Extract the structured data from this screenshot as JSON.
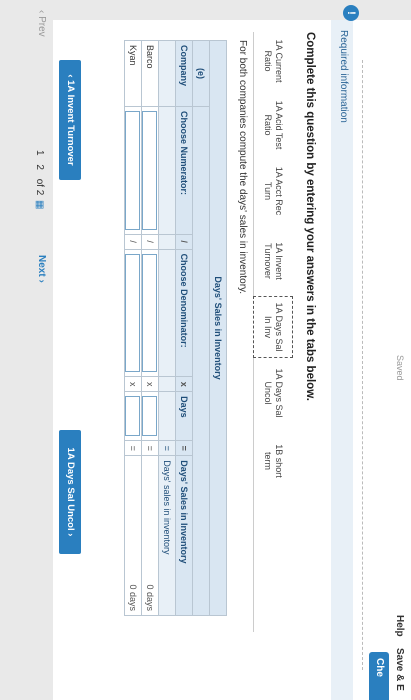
{
  "header": {
    "status": "Saved",
    "help": "Help",
    "save": "Save & E",
    "check": "Che"
  },
  "alert": {
    "icon_text": "!",
    "required": "Required information"
  },
  "question": "Complete this question by entering your answers in the tabs below.",
  "tabs": [
    {
      "label": "1A Current Ratio"
    },
    {
      "label": "1A Acid Test Ratio"
    },
    {
      "label": "1A Acct Rec Turn"
    },
    {
      "label": "1A Invent Turnover"
    },
    {
      "label": "1A Days Sal In Inv"
    },
    {
      "label": "1A Days Sal Uncol"
    },
    {
      "label": "1B short term"
    }
  ],
  "instruction": "For both companies compute the days' sales in inventory.",
  "table": {
    "title": "Days' Sales in Inventory",
    "col_sub": "(e)",
    "headers": {
      "company": "Company",
      "numerator": "Choose Numerator:",
      "slash": "/",
      "denominator": "Choose Denominator:",
      "times": "x",
      "days": "Days",
      "equals": "=",
      "result": "Days' Sales in Inventory"
    },
    "result_sub": "Days' sales in inventory",
    "rows": [
      {
        "company": "Barco",
        "slash": "/",
        "times": "x",
        "equals": "=",
        "result": "0 days"
      },
      {
        "company": "Kyan",
        "slash": "/",
        "times": "x",
        "equals": "=",
        "result": "0 days"
      }
    ]
  },
  "nav": {
    "prev": "1A Invent Turnover",
    "next": "1A Days Sal Uncol"
  },
  "pagination": {
    "prev": "Prev",
    "page": "1",
    "page2": "2",
    "of": "of 2",
    "next": "Next"
  }
}
